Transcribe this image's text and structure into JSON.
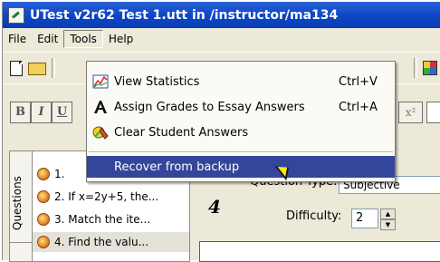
{
  "window": {
    "title": "UTest v2r62 Test 1.utt in /instructor/ma134"
  },
  "menubar": {
    "items": [
      "File",
      "Edit",
      "Tools",
      "Help"
    ]
  },
  "tools_menu": {
    "items": [
      {
        "label": "View Statistics",
        "shortcut": "Ctrl+V",
        "icon": "statistics-chart-icon"
      },
      {
        "label": "Assign Grades to Essay Answers",
        "shortcut": "Ctrl+A",
        "icon": "serif-letter-a-icon"
      },
      {
        "label": "Clear Student Answers",
        "shortcut": "",
        "icon": "clear-answers-icon"
      },
      {
        "label": "Recover from backup",
        "shortcut": "",
        "icon": "",
        "highlighted": true
      }
    ]
  },
  "format_toolbar": {
    "bold": "B",
    "italic": "I",
    "underline": "U",
    "superscript": "x²"
  },
  "side_tabs": {
    "questions": "Questions"
  },
  "question_list": {
    "items": [
      "1.",
      "2. If x=2y+5, the...",
      "3. Match the ite...",
      "4. Find the valu..."
    ]
  },
  "question_detail": {
    "number": "4",
    "type_label": "Question Type:",
    "type_value": "Subjective",
    "difficulty_label": "Difficulty:",
    "difficulty_value": "2"
  }
}
